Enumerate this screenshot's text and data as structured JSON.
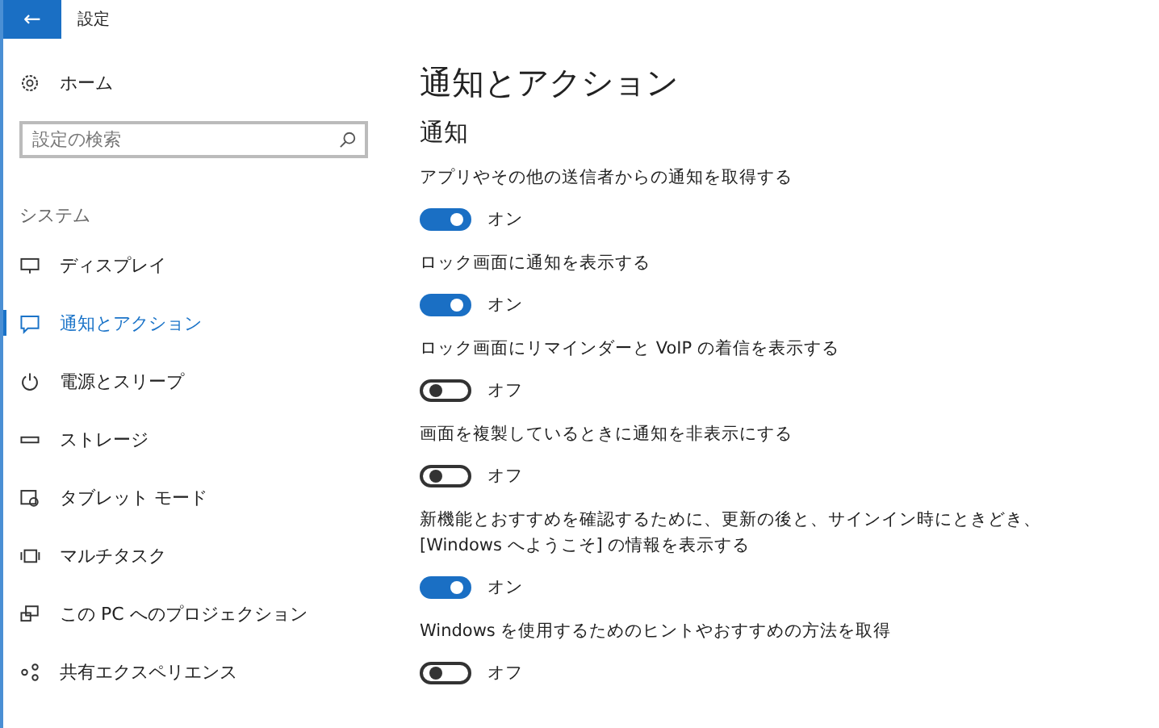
{
  "window": {
    "title": "設定",
    "back_button": "←"
  },
  "sidebar": {
    "home": "ホーム",
    "search": {
      "placeholder": "設定の検索"
    },
    "section": "システム",
    "items": [
      {
        "label": "ディスプレイ",
        "kind": "display",
        "selected": false
      },
      {
        "label": "通知とアクション",
        "kind": "notify",
        "selected": true
      },
      {
        "label": "電源とスリープ",
        "kind": "power",
        "selected": false
      },
      {
        "label": "ストレージ",
        "kind": "storage",
        "selected": false
      },
      {
        "label": "タブレット モード",
        "kind": "tablet",
        "selected": false
      },
      {
        "label": "マルチタスク",
        "kind": "multitask",
        "selected": false
      },
      {
        "label": "この PC へのプロジェクション",
        "kind": "project",
        "selected": false
      },
      {
        "label": "共有エクスペリエンス",
        "kind": "share",
        "selected": false
      }
    ]
  },
  "page": {
    "title": "通知とアクション",
    "section": "通知",
    "settings": [
      {
        "label": "アプリやその他の送信者からの通知を取得する",
        "on": true,
        "state": "オン"
      },
      {
        "label": "ロック画面に通知を表示する",
        "on": true,
        "state": "オン"
      },
      {
        "label": "ロック画面にリマインダーと VoIP の着信を表示する",
        "on": false,
        "state": "オフ"
      },
      {
        "label": "画面を複製しているときに通知を非表示にする",
        "on": false,
        "state": "オフ"
      },
      {
        "label": "新機能とおすすめを確認するために、更新の後と、サインイン時にときどき、[Windows へようこそ] の情報を表示する",
        "on": true,
        "state": "オン"
      },
      {
        "label": "Windows を使用するためのヒントやおすすめの方法を取得",
        "on": false,
        "state": "オフ"
      }
    ]
  }
}
